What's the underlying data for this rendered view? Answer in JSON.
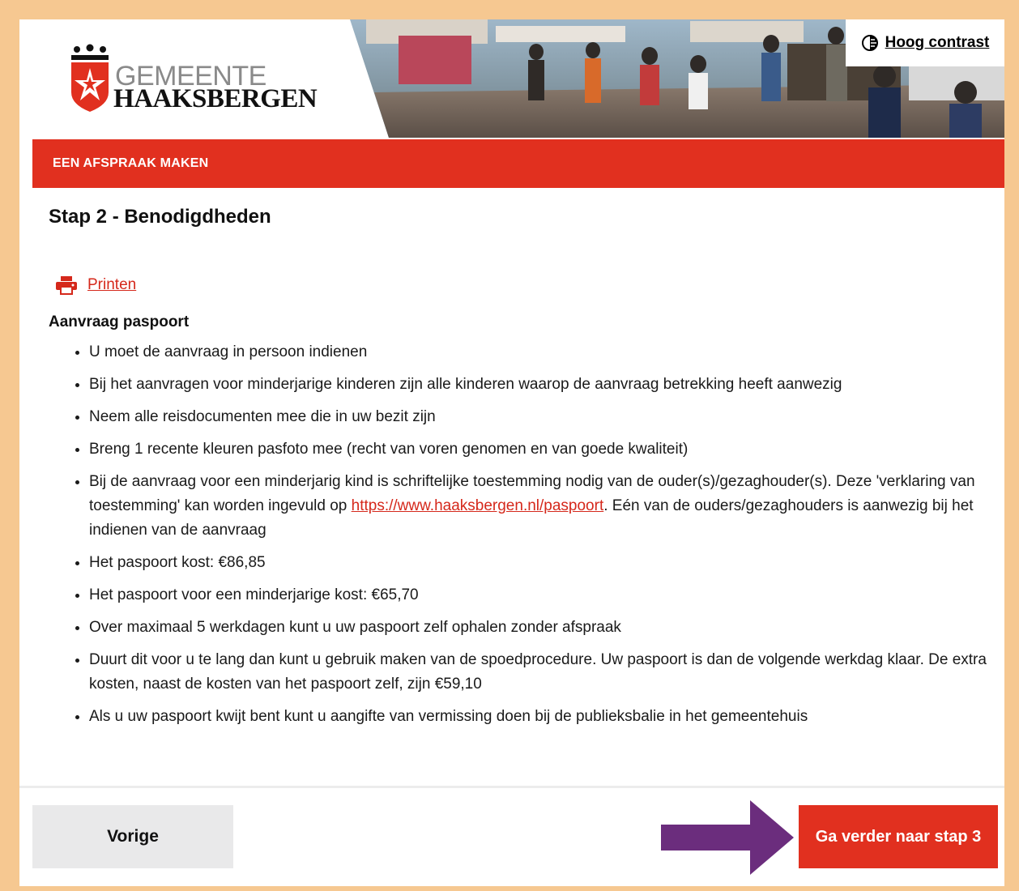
{
  "header": {
    "logo_line1": "GEMEENTE",
    "logo_line2": "HAAKSBERGEN",
    "contrast_label": "Hoog contrast"
  },
  "banner": {
    "title": "EEN AFSPRAAK MAKEN"
  },
  "step": {
    "title": "Stap 2 - Benodigdheden"
  },
  "print": {
    "label": "Printen"
  },
  "section": {
    "title": "Aanvraag paspoort",
    "items": [
      "U moet de aanvraag in persoon indienen",
      "Bij het aanvragen voor minderjarige kinderen zijn alle kinderen waarop de aanvraag betrekking heeft aanwezig",
      "Neem alle reisdocumenten mee die in uw bezit zijn",
      "Breng 1 recente kleuren pasfoto mee (recht van voren genomen en van goede kwaliteit)",
      {
        "before": "Bij de aanvraag voor een minderjarig kind is schriftelijke toestemming nodig van de ouder(s)/gezaghouder(s). Deze 'verklaring van toestemming' kan worden ingevuld op ",
        "link": "https://www.haaksbergen.nl/paspoort",
        "after": ". Eén van de ouders/gezaghouders is aanwezig bij het indienen van de aanvraag"
      },
      "Het paspoort kost: €86,85",
      "Het paspoort voor een minderjarige kost: €65,70",
      "Over maximaal 5 werkdagen kunt u uw paspoort zelf ophalen zonder afspraak",
      "Duurt dit voor u te lang dan kunt u gebruik maken van de spoedprocedure. Uw paspoort is dan de volgende werkdag klaar. De extra kosten, naast de kosten van het paspoort zelf, zijn €59,10",
      "Als u uw paspoort kwijt bent kunt u aangifte van vermissing doen bij de publieksbalie in het gemeentehuis"
    ]
  },
  "footer": {
    "prev_label": "Vorige",
    "next_label": "Ga verder naar stap 3"
  },
  "colors": {
    "brand_red": "#e1301f",
    "page_border": "#f6c891",
    "arrow": "#6b2d7d"
  },
  "icons": {
    "contrast": "contrast-icon",
    "print": "printer-icon",
    "arrow": "arrow-right-icon",
    "logo": "crest-icon"
  }
}
